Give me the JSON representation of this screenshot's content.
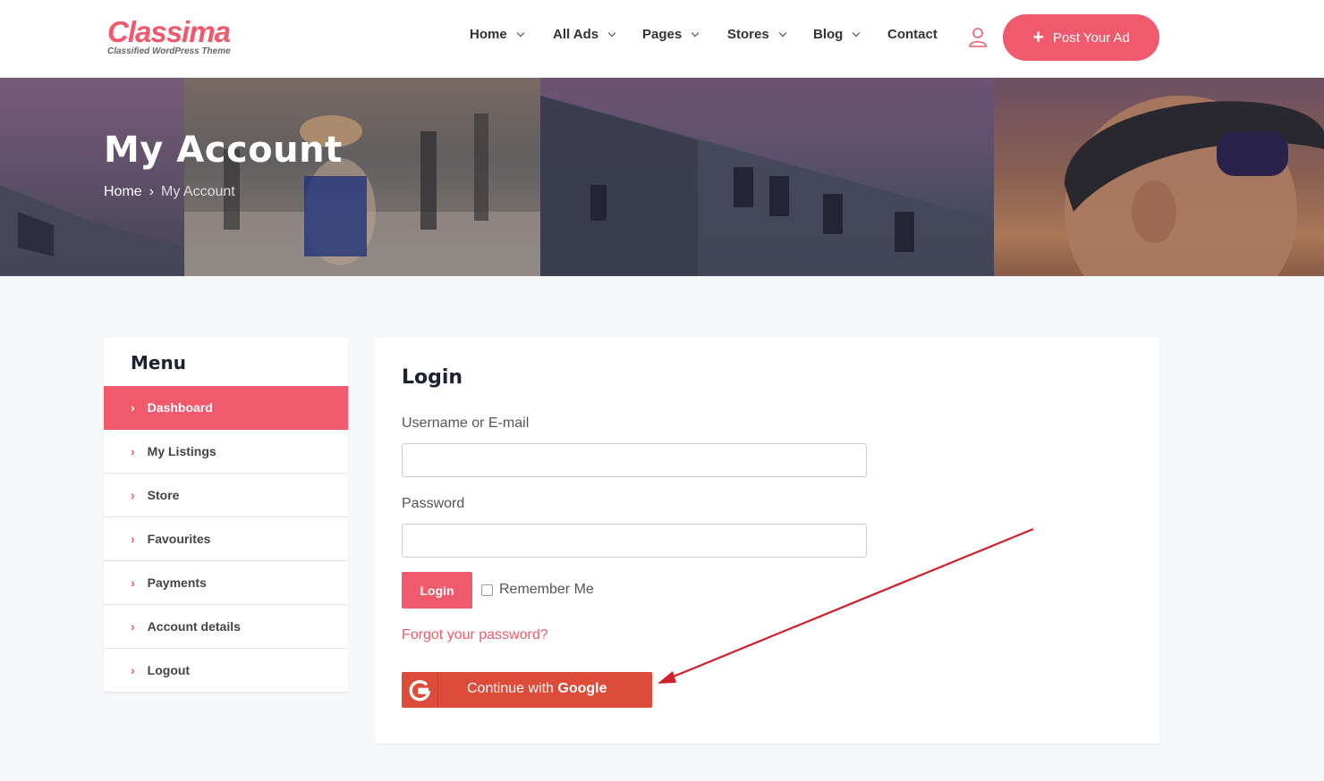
{
  "header": {
    "logo_text": "Classima",
    "logo_tagline": "Classified WordPress Theme",
    "nav": [
      {
        "label": "Home",
        "dropdown": true
      },
      {
        "label": "All Ads",
        "dropdown": true
      },
      {
        "label": "Pages",
        "dropdown": true
      },
      {
        "label": "Stores",
        "dropdown": true
      },
      {
        "label": "Blog",
        "dropdown": true
      },
      {
        "label": "Contact",
        "dropdown": false
      }
    ],
    "user_icon": "user-icon",
    "post_button_label": "Post Your Ad",
    "accent_color": "#f05a6c"
  },
  "hero": {
    "title": "My Account",
    "breadcrumb": {
      "home": "Home",
      "current": "My Account"
    }
  },
  "sidebar": {
    "heading": "Menu",
    "items": [
      {
        "label": "Dashboard",
        "active": true
      },
      {
        "label": "My Listings",
        "active": false
      },
      {
        "label": "Store",
        "active": false
      },
      {
        "label": "Favourites",
        "active": false
      },
      {
        "label": "Payments",
        "active": false
      },
      {
        "label": "Account details",
        "active": false
      },
      {
        "label": "Logout",
        "active": false
      }
    ]
  },
  "login": {
    "title": "Login",
    "username_label": "Username or E-mail",
    "username_value": "",
    "password_label": "Password",
    "password_value": "",
    "login_button": "Login",
    "remember_label": "Remember Me",
    "remember_checked": false,
    "forgot_link": "Forgot your password?",
    "google_prefix": "Continue with ",
    "google_brand": "Google",
    "google_color": "#dd4b39"
  },
  "annotation": {
    "arrow_color": "#d0202a"
  }
}
